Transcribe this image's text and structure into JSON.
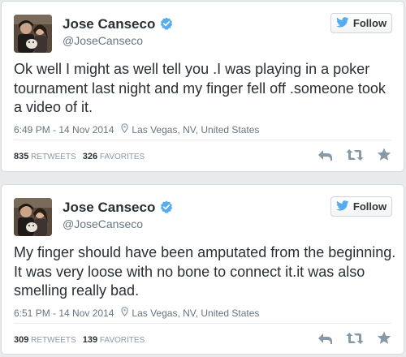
{
  "tweets": [
    {
      "display_name": "Jose Canseco",
      "screen_name": "@JoseCanseco",
      "follow_label": "Follow",
      "text": "Ok well I might as well tell you .I was playing in a poker tournament last night and my finger fell off .someone took a video of it.",
      "timestamp": "6:49 PM - 14 Nov 2014",
      "location": "Las Vegas, NV, United States",
      "retweets_count": "835",
      "retweets_label": "RETWEETS",
      "favorites_count": "326",
      "favorites_label": "FAVORITES"
    },
    {
      "display_name": "Jose Canseco",
      "screen_name": "@JoseCanseco",
      "follow_label": "Follow",
      "text": "My finger should have been amputated from the beginning. It was very loose with no bone to connect it.it was also smelling really bad.",
      "timestamp": "6:51 PM - 14 Nov 2014",
      "location": "Las Vegas, NV, United States",
      "retweets_count": "309",
      "retweets_label": "RETWEETS",
      "favorites_count": "139",
      "favorites_label": "FAVORITES"
    }
  ],
  "icons": {
    "verified": "verified-badge-icon",
    "bird": "twitter-bird-icon",
    "location": "map-pin-icon",
    "reply": "reply-icon",
    "retweet": "retweet-icon",
    "favorite": "star-icon"
  },
  "colors": {
    "verified_blue": "#55acee",
    "bird_blue": "#55acee",
    "text": "#292f33",
    "muted": "#66757f",
    "action_gray": "#8899a6"
  }
}
